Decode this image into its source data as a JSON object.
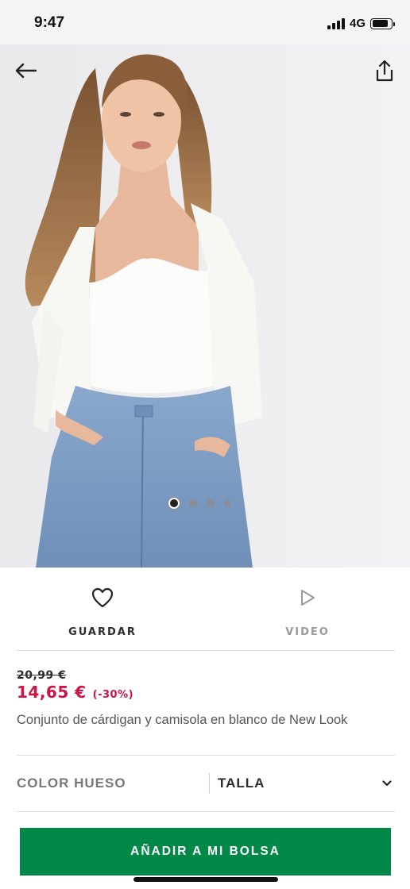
{
  "status_bar": {
    "time": "9:47",
    "network": "4G",
    "battery_level": 0.85
  },
  "hero": {
    "icons": {
      "back": "arrow-left-icon",
      "share": "share-icon"
    },
    "carousel": {
      "total": 4,
      "active_index": 1
    }
  },
  "actions": {
    "save_label": "GUARDAR",
    "video_label": "VIDEO"
  },
  "product": {
    "price_old": "20,99 €",
    "price_new": "14,65 €",
    "discount": "(-30%)",
    "title": "Conjunto de cárdigan y camisola en blanco de New Look"
  },
  "selectors": {
    "color_label": "COLOR HUESO",
    "size_label": "TALLA"
  },
  "cta": {
    "label": "AÑADIR A MI BOLSA"
  },
  "colors": {
    "price_accent": "#d01345",
    "cta_green": "#018849"
  }
}
